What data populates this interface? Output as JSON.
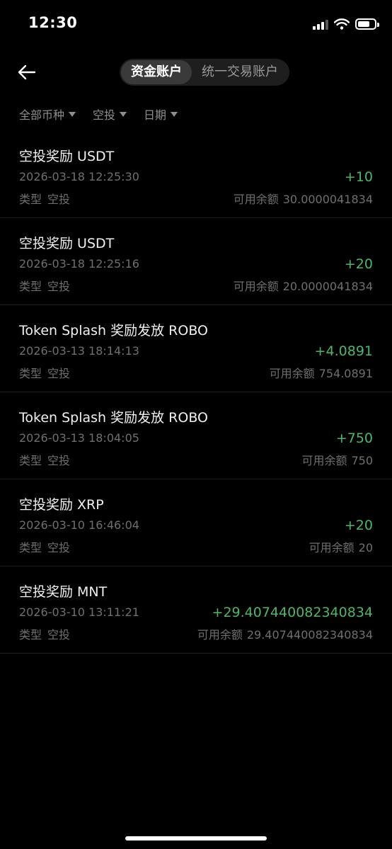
{
  "status_bar": {
    "time": "12:30"
  },
  "header": {
    "tabs": [
      {
        "label": "资金账户",
        "active": true
      },
      {
        "label": "统一交易账户",
        "active": false
      }
    ]
  },
  "filters": [
    {
      "label": "全部币种"
    },
    {
      "label": "空投"
    },
    {
      "label": "日期"
    }
  ],
  "labels": {
    "type": "类型",
    "balance": "可用余额"
  },
  "colors": {
    "positive": "#4fb567",
    "background": "#000000",
    "muted": "#6f6f6f"
  },
  "records": [
    {
      "title": "空投奖励 USDT",
      "time": "2026-03-18 12:25:30",
      "type": "空投",
      "amount": "+10",
      "balance": "30.0000041834"
    },
    {
      "title": "空投奖励 USDT",
      "time": "2026-03-18 12:25:16",
      "type": "空投",
      "amount": "+20",
      "balance": "20.0000041834"
    },
    {
      "title": "Token Splash 奖励发放 ROBO",
      "time": "2026-03-13 18:14:13",
      "type": "空投",
      "amount": "+4.0891",
      "balance": "754.0891"
    },
    {
      "title": "Token Splash 奖励发放 ROBO",
      "time": "2026-03-13 18:04:05",
      "type": "空投",
      "amount": "+750",
      "balance": "750"
    },
    {
      "title": "空投奖励 XRP",
      "time": "2026-03-10 16:46:04",
      "type": "空投",
      "amount": "+20",
      "balance": "20"
    },
    {
      "title": "空投奖励 MNT",
      "time": "2026-03-10 13:11:21",
      "type": "空投",
      "amount": "+29.407440082340834",
      "balance": "29.407440082340834"
    }
  ]
}
